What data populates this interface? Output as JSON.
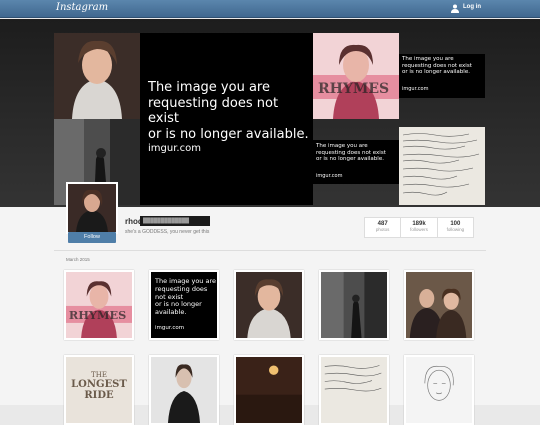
{
  "topbar": {
    "logo": "Instagram",
    "login_label": "Log in",
    "color": "#4a76a0"
  },
  "hero": {
    "notfound_big": {
      "line1": "The image you are",
      "line2": "requesting does not exist",
      "line3": "or is no longer available.",
      "url": "imgur.com"
    },
    "notfound_small": {
      "line1": "The image you are",
      "line2": "requesting does not exist",
      "line3": "or is no longer available.",
      "url": "imgur.com"
    }
  },
  "profile": {
    "username_prefix": "rhod",
    "username_redacted": "█████████████",
    "bio": "she's a GODDESS, you never get this",
    "follow_label": "Follow",
    "stats": [
      {
        "value": "487",
        "label": "photos"
      },
      {
        "value": "189k",
        "label": "followers"
      },
      {
        "value": "100",
        "label": "following"
      }
    ]
  },
  "feed": {
    "month": "March 2015",
    "grid_notfound": {
      "line1": "The image you are",
      "line2": "requesting does not exist",
      "line3": "or is no longer available.",
      "url": "imgur.com"
    },
    "longest_ride": {
      "line1": "THE",
      "line2": "LONGEST",
      "line3": "RIDE"
    }
  }
}
